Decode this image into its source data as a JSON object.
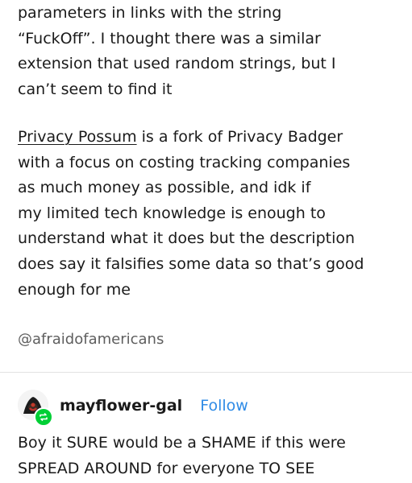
{
  "post": {
    "paragraph1": "parameters in links with the string\n“FuckOff”. I thought there was a similar\nextension that used random strings, but I\ncan’t seem to find it",
    "paragraph2_link": "Privacy Possum",
    "paragraph2_rest": " is a fork of Privacy Badger\nwith a focus on costing tracking companies\nas much money as possible, and idk if\nmy limited tech knowledge is enough to\nunderstand what it does but the description\ndoes say it falsifies some data so that’s good\nenough for me",
    "attribution": "@afraidofamericans"
  },
  "reblog": {
    "username": "mayflower-gal",
    "follow_label": "Follow",
    "body": "Boy it SURE would be a SHAME if this were\nSPREAD AROUND for everyone TO SEE",
    "badge_color": "#00cf35",
    "follow_color": "#2f8be6"
  }
}
